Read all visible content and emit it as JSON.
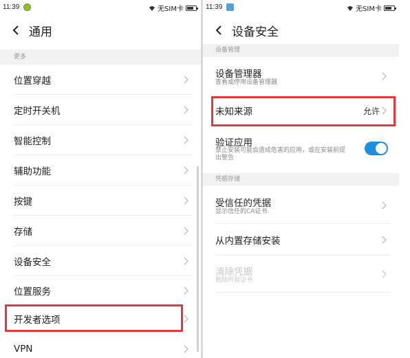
{
  "left": {
    "status": {
      "time": "11:39",
      "sim": "无SIM卡"
    },
    "title": "通用",
    "section_label": "更多",
    "items": [
      {
        "label": "位置穿越"
      },
      {
        "label": "定时开关机"
      },
      {
        "label": "智能控制"
      },
      {
        "label": "辅助功能"
      },
      {
        "label": "按键"
      },
      {
        "label": "存储"
      },
      {
        "label": "设备安全"
      },
      {
        "label": "位置服务"
      },
      {
        "label": "开发者选项"
      },
      {
        "label": "VPN"
      }
    ]
  },
  "right": {
    "status": {
      "time": "11:39",
      "sim": "无SIM卡"
    },
    "title": "设备安全",
    "sections": [
      {
        "label": "设备管理"
      },
      {
        "label": "凭据存储"
      }
    ],
    "items": [
      {
        "label": "设备管理器",
        "sub": "查看或停用设备管理器"
      },
      {
        "label": "未知来源",
        "value": "允许"
      },
      {
        "label": "验证应用",
        "sub1": "禁止安装可能会造成危害的应用，或在安装前提",
        "sub2": "出警告",
        "toggle_on": true
      },
      {
        "label": "受信任的凭据",
        "sub": "显示信任的CA证书"
      },
      {
        "label": "从内置存储安装"
      },
      {
        "label": "清除凭据",
        "sub": "删除所有证书"
      }
    ]
  },
  "colors": {
    "highlight": "#e23a3a",
    "toggle": "#1e8fe1"
  }
}
